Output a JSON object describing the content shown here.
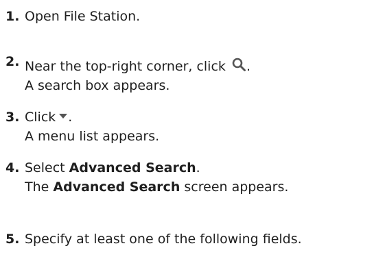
{
  "steps": [
    {
      "number": "1.",
      "text": "Open File Station."
    },
    {
      "number": "2.",
      "text_before_icon": "Near the top-right corner, click",
      "icon": "search-icon",
      "text_after_icon": ".",
      "result": "A search box appears."
    },
    {
      "number": "3.",
      "text_before_icon": "Click",
      "icon": "dropdown-triangle-icon",
      "text_after_icon": ".",
      "result": "A menu list appears."
    },
    {
      "number": "4.",
      "text_before": "Select",
      "bold": "Advanced Search",
      "text_after": ".",
      "result_before": "The",
      "result_bold": "Advanced Search",
      "result_after": "screen appears."
    },
    {
      "number": "5.",
      "text": "Specify at least one of the following fields."
    }
  ],
  "colors": {
    "text": "#1f1f1f",
    "icon": "#555555"
  }
}
